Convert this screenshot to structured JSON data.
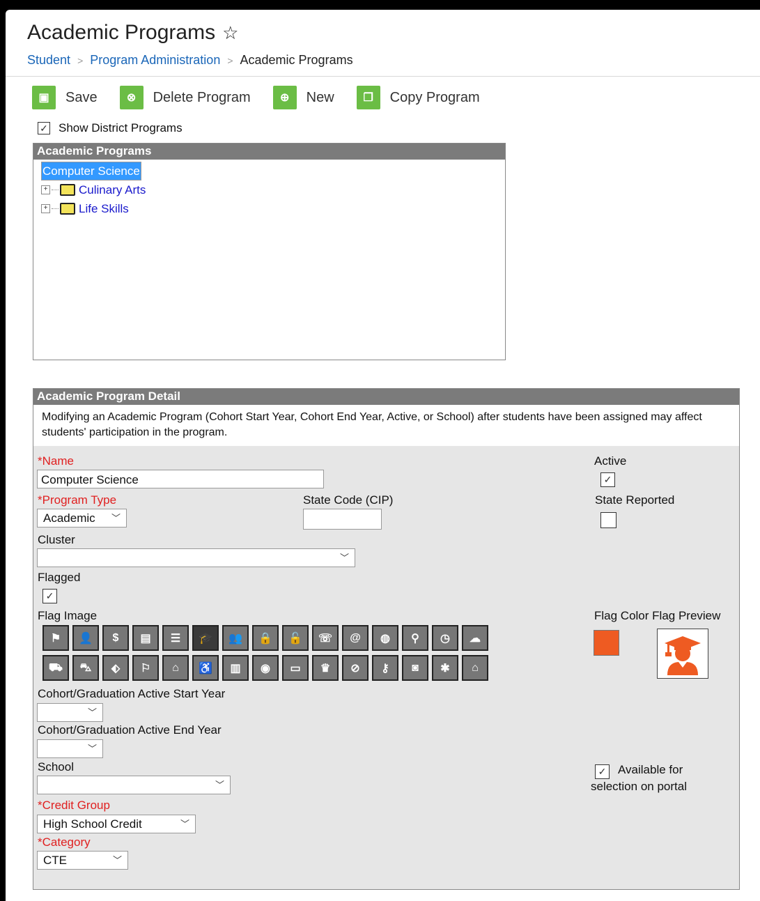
{
  "page": {
    "title": "Academic Programs"
  },
  "breadcrumb": [
    "Student",
    "Program Administration",
    "Academic Programs"
  ],
  "toolbar": {
    "save": "Save",
    "delete": "Delete Program",
    "new": "New",
    "copy": "Copy Program"
  },
  "show_district": {
    "label": "Show District Programs",
    "checked": true
  },
  "tree": {
    "header": "Academic Programs",
    "items": [
      {
        "label": "Computer Science",
        "selected": true
      },
      {
        "label": "Culinary Arts",
        "selected": false
      },
      {
        "label": "Life Skills",
        "selected": false
      }
    ]
  },
  "detail": {
    "header": "Academic Program Detail",
    "note": "Modifying an Academic Program (Cohort Start Year, Cohort End Year, Active, or School) after students have been assigned may affect students' participation in the program.",
    "name_label": "Name",
    "name_value": "Computer Science",
    "program_type_label": "Program Type",
    "program_type_value": "Academic",
    "state_code_label": "State Code (CIP)",
    "state_code_value": "",
    "cluster_label": "Cluster",
    "cluster_value": "",
    "flagged_label": "Flagged",
    "flagged": true,
    "flag_image_label": "Flag Image",
    "active_label": "Active",
    "active": true,
    "state_reported_label": "State Reported",
    "state_reported": false,
    "flag_color_label": "Flag Color",
    "flag_preview_label": "Flag Preview",
    "flag_color": "#ee5b22",
    "cohort_start_label": "Cohort/Graduation Active Start Year",
    "cohort_start_value": "",
    "cohort_end_label": "Cohort/Graduation Active End Year",
    "cohort_end_value": "",
    "school_label": "School",
    "school_value": "",
    "portal_label": "Available for selection on portal",
    "portal": true,
    "credit_group_label": "Credit Group",
    "credit_group_value": "High School Credit",
    "category_label": "Category",
    "category_value": "CTE",
    "required_marker": "*"
  },
  "flag_icons_row1": [
    "flag-icon",
    "user-check-icon",
    "dollar-icon",
    "id-card-icon",
    "checklist-icon",
    "graduate-icon",
    "users-icon",
    "lock-icon",
    "unlock-icon",
    "phone-icon",
    "at-icon",
    "globe-icon",
    "map-pin-icon",
    "clock-icon",
    "cloud-icon"
  ],
  "flag_icons_row2": [
    "car-icon",
    "bus-icon",
    "tag-icon",
    "running-icon",
    "institution-icon",
    "wheelchair-icon",
    "book-icon",
    "eye-icon",
    "monitor-icon",
    "trophy-icon",
    "ban-icon",
    "key-icon",
    "camera-icon",
    "asterisk-icon",
    "home-icon"
  ],
  "flag_glyphs_row1": [
    "⚑",
    "👤",
    "$",
    "▤",
    "☰",
    "🎓",
    "👥",
    "🔒",
    "🔓",
    "☏",
    "@",
    "◍",
    "⚲",
    "◷",
    "☁"
  ],
  "flag_glyphs_row2": [
    "⛟",
    "⛍",
    "⬖",
    "⚐",
    "⌂",
    "♿",
    "▥",
    "◉",
    "▭",
    "♛",
    "⊘",
    "⚷",
    "◙",
    "✱",
    "⌂"
  ]
}
